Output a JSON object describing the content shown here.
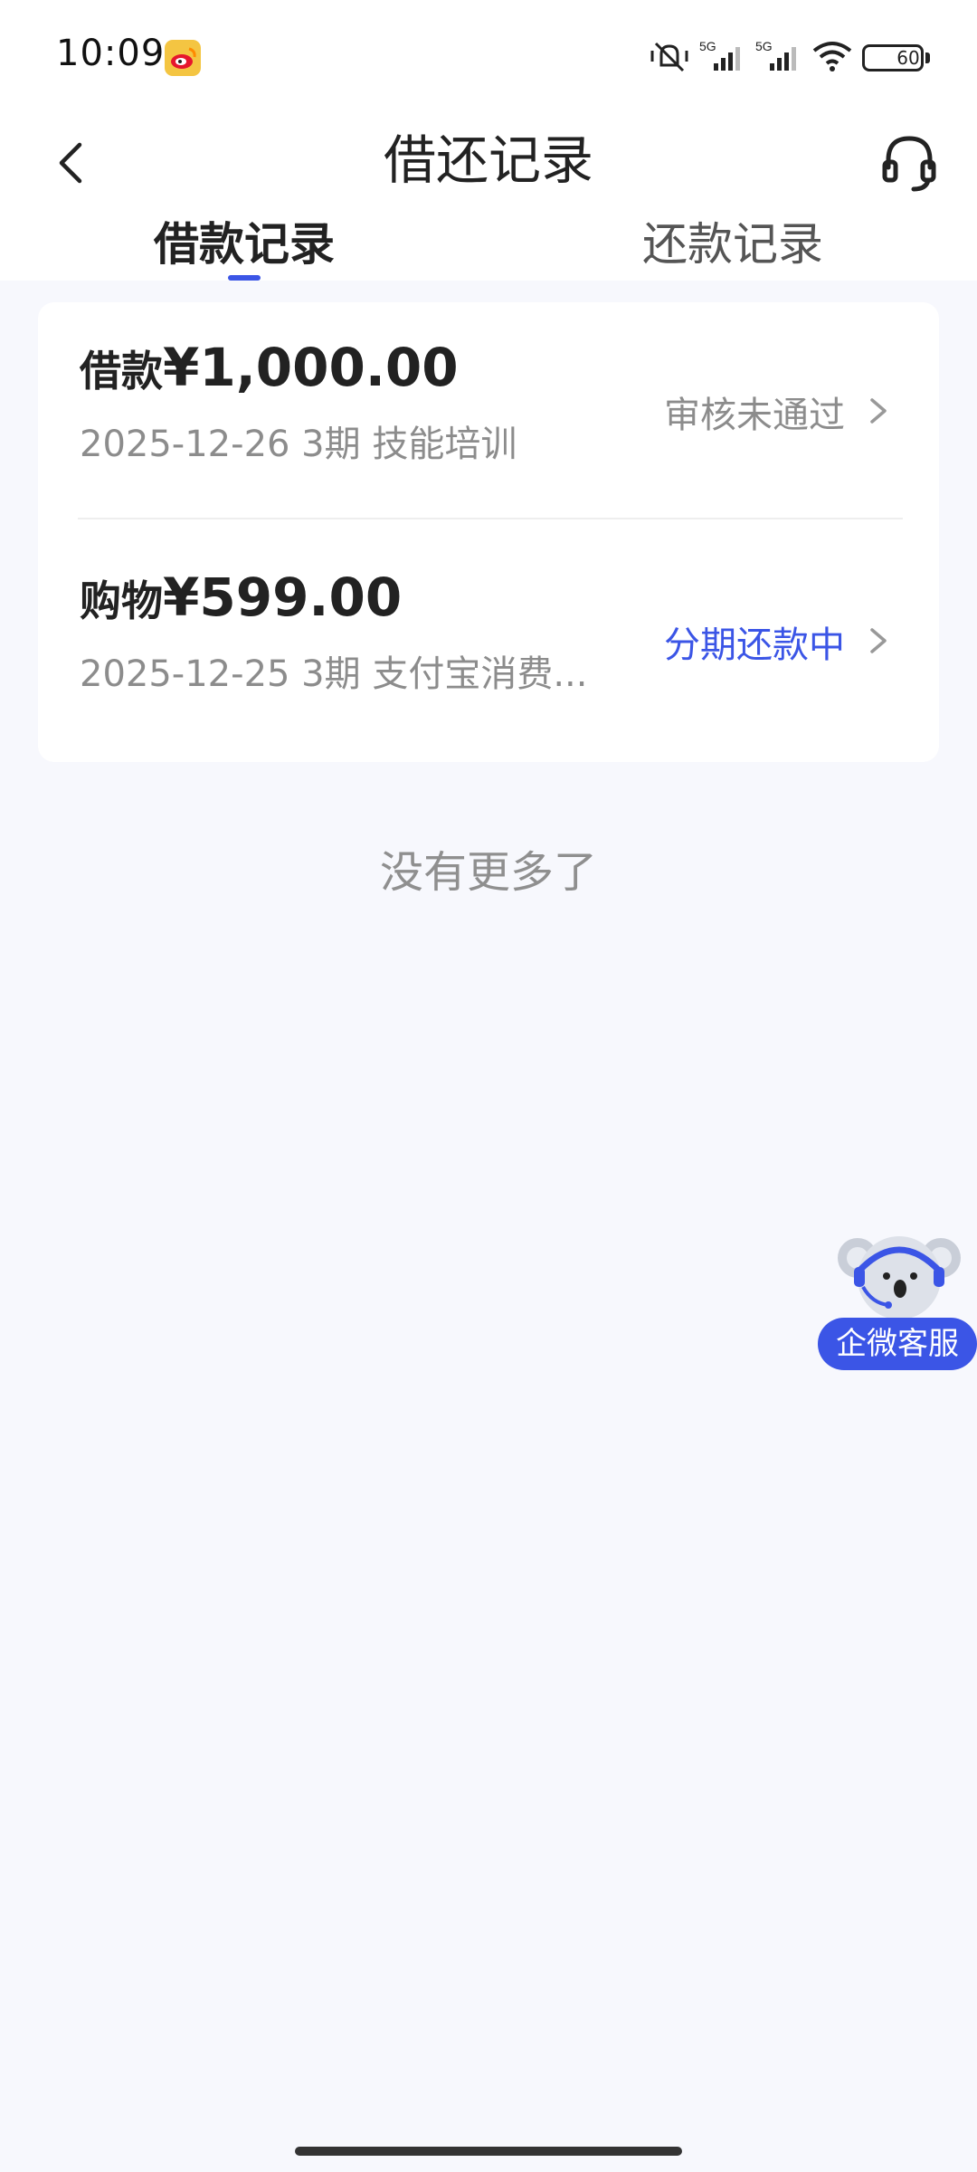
{
  "status_bar": {
    "time": "10:09",
    "app_icon": "weibo-icon",
    "network_1": "5G",
    "network_2": "5G",
    "battery_percent": 60,
    "battery_label": "60"
  },
  "nav": {
    "title": "借还记录",
    "back_icon": "chevron-left-icon",
    "service_icon": "headset-icon"
  },
  "tabs": [
    {
      "label": "借款记录",
      "active": true
    },
    {
      "label": "还款记录",
      "active": false
    }
  ],
  "records": [
    {
      "type": "借款",
      "amount": "¥1,000.00",
      "meta": "2025-12-26 3期  技能培训",
      "status": "审核未通过",
      "status_color": "#8c8c8c"
    },
    {
      "type": "购物",
      "amount": "¥599.00",
      "meta": "2025-12-25 3期  支付宝消费...",
      "status": "分期还款中",
      "status_color": "#3b55e6"
    }
  ],
  "footer": {
    "no_more": "没有更多了"
  },
  "floating_service": {
    "label": "企微客服",
    "icon": "koala-mascot-icon"
  },
  "colors": {
    "accent": "#3b55e6",
    "background": "#f7f8fd"
  }
}
